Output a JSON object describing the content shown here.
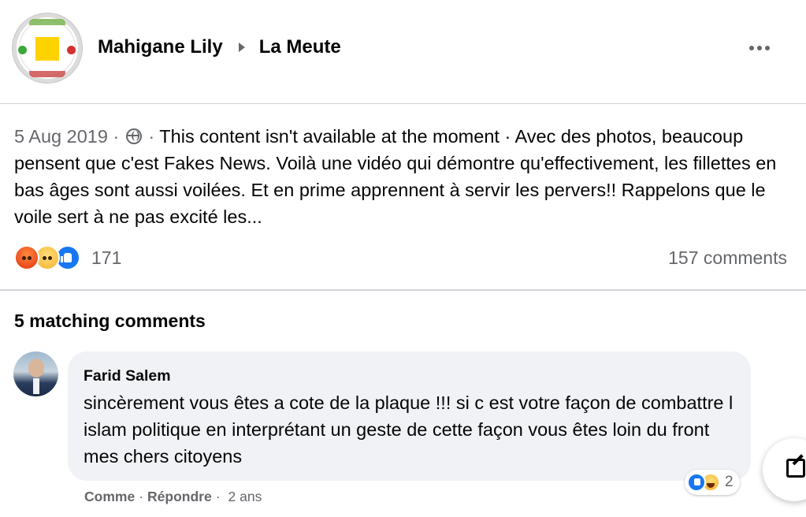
{
  "header": {
    "author": "Mahigane Lily",
    "group": "La Meute"
  },
  "post": {
    "date": "5 Aug 2019",
    "separator": "·",
    "privacy_icon": "globe-icon",
    "text_main": "This content isn't available at the moment · Avec des photos, beaucoup pensent que c'est Fakes News. Voilà une vidéo qui démontre qu'effectivement, les fillettes en bas âges sont aussi voilées. Et en prime apprennent à servir les pervers!! Rappelons que le voile sert à ne pas excité les...",
    "reaction_count": "171",
    "comments_count": "157 comments"
  },
  "matching": {
    "title": "5 matching comments"
  },
  "comment": {
    "author": "Farid Salem",
    "text": "sincèrement vous êtes a cote de la plaque !!! si c est votre façon de combattre l islam politique en interprétant un geste de cette façon vous êtes loin du front mes chers citoyens",
    "reaction_count": "2",
    "like_label": "Comme",
    "reply_label": "Répondre",
    "time": "2 ans",
    "dot": "·"
  },
  "colors": {
    "text": "#050505",
    "secondary": "#65676b",
    "bubble": "#f0f2f5",
    "like_blue": "#1877f2"
  }
}
